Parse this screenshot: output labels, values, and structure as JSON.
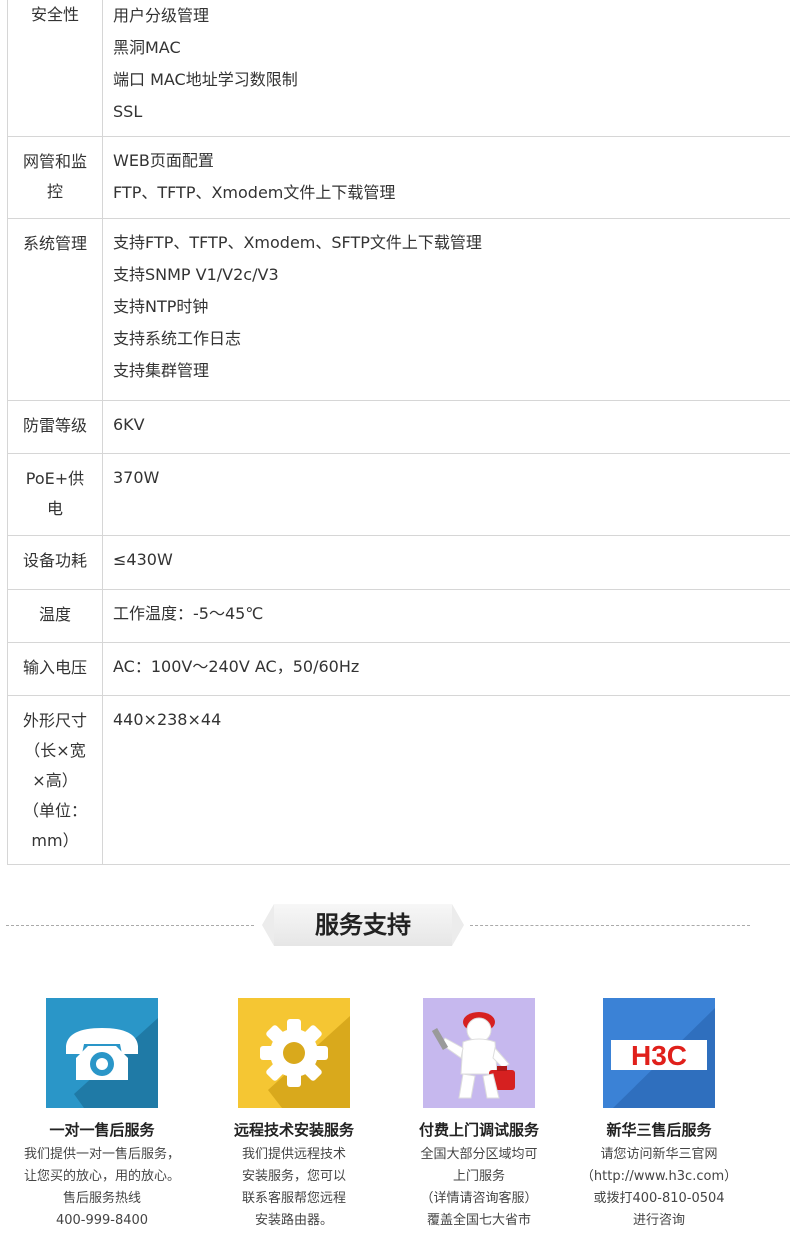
{
  "specs": [
    {
      "key": [
        "安全性"
      ],
      "values": [
        "用户分级管理",
        "黑洞MAC",
        "端口 MAC地址学习数限制",
        "SSL"
      ]
    },
    {
      "key": [
        "网管和监",
        "控"
      ],
      "values": [
        "WEB页面配置",
        "FTP、TFTP、Xmodem文件上下载管理"
      ]
    },
    {
      "key": [
        "系统管理"
      ],
      "values": [
        "支持FTP、TFTP、Xmodem、SFTP文件上下载管理",
        "支持SNMP V1/V2c/V3",
        "支持NTP时钟",
        "支持系统工作日志",
        "支持集群管理"
      ]
    },
    {
      "key": [
        "防雷等级"
      ],
      "values": [
        "6KV"
      ]
    },
    {
      "key": [
        "PoE+供",
        "电"
      ],
      "values": [
        "370W"
      ]
    },
    {
      "key": [
        "设备功耗"
      ],
      "values": [
        "≤430W"
      ]
    },
    {
      "key": [
        "温度"
      ],
      "values": [
        "工作温度：-5～45℃"
      ]
    },
    {
      "key": [
        "输入电压"
      ],
      "values": [
        "AC：100V～240V AC，50/60Hz"
      ]
    },
    {
      "key": [
        "外形尺寸",
        "（长×宽",
        "×高）",
        "（单位：",
        "mm）"
      ],
      "values": [
        "440×238×44"
      ]
    }
  ],
  "section": {
    "title": "服务支持"
  },
  "services": [
    {
      "name": "一对一售后服务",
      "icon": "telephone-icon",
      "color": "#2a96c8",
      "desc": [
        "我们提供一对一售后服务，",
        "让您买的放心，用的放心。",
        "售后服务热线",
        "400-999-8400"
      ]
    },
    {
      "name": "远程技术安装服务",
      "icon": "gear-icon",
      "color": "#f5c633",
      "desc": [
        "我们提供远程技术",
        "安装服务，您可以",
        "联系客服帮您远程",
        "安装路由器。"
      ]
    },
    {
      "name": "付费上门调试服务",
      "icon": "technician-icon",
      "color": "#c6b8ee",
      "desc": [
        "全国大部分区域均可",
        "上门服务",
        "（详情请咨询客服）",
        "覆盖全国七大省市"
      ]
    },
    {
      "name": "新华三售后服务",
      "icon": "h3c-logo",
      "logo_text": "H3C",
      "color": "#3b82d6",
      "desc": [
        "请您访问新华三官网",
        "（http://www.h3c.com）",
        "或拨打400-810-0504",
        "进行咨询"
      ]
    }
  ]
}
